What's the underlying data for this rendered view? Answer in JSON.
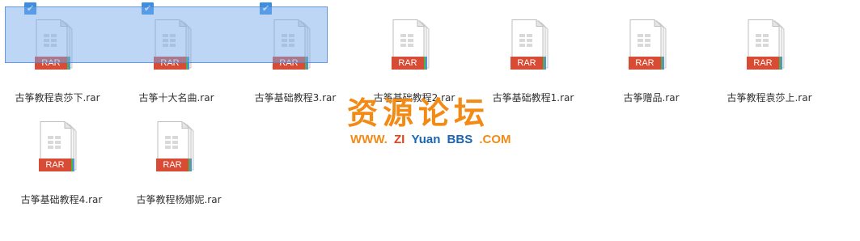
{
  "files": [
    {
      "name": "古筝教程袁莎下.rar",
      "selected": true,
      "badge": "RAR"
    },
    {
      "name": "古筝十大名曲.rar",
      "selected": true,
      "badge": "RAR"
    },
    {
      "name": "古筝基础教程3.rar",
      "selected": true,
      "badge": "RAR"
    },
    {
      "name": "古筝基础教程2.rar",
      "selected": false,
      "badge": "RAR"
    },
    {
      "name": "古筝基础教程1.rar",
      "selected": false,
      "badge": "RAR"
    },
    {
      "name": "古筝赠品.rar",
      "selected": false,
      "badge": "RAR"
    },
    {
      "name": "古筝教程袁莎上.rar",
      "selected": false,
      "badge": "RAR"
    },
    {
      "name": "古筝基础教程4.rar",
      "selected": false,
      "badge": "RAR"
    },
    {
      "name": "古筝教程杨娜妮.rar",
      "selected": false,
      "badge": "RAR"
    }
  ],
  "watermark": {
    "cn": "资源论坛",
    "en_www": "WWW.",
    "en_zi": "ZI",
    "en_yuan": "Yuan",
    "en_bbs": "BBS",
    "en_com": ".COM"
  },
  "icons": {
    "file": "rar-archive-icon",
    "check": "checkmark-icon"
  },
  "colors": {
    "selection_border": "#3c8ee3",
    "selection_fill": "#78aaeb",
    "rar_red": "#d84b35",
    "rar_green": "#4caf50",
    "rar_blue": "#5b8fd6",
    "watermark_orange": "#f28a14",
    "watermark_red": "#e8401c",
    "watermark_blue": "#1c64b4",
    "text": "#333333"
  }
}
